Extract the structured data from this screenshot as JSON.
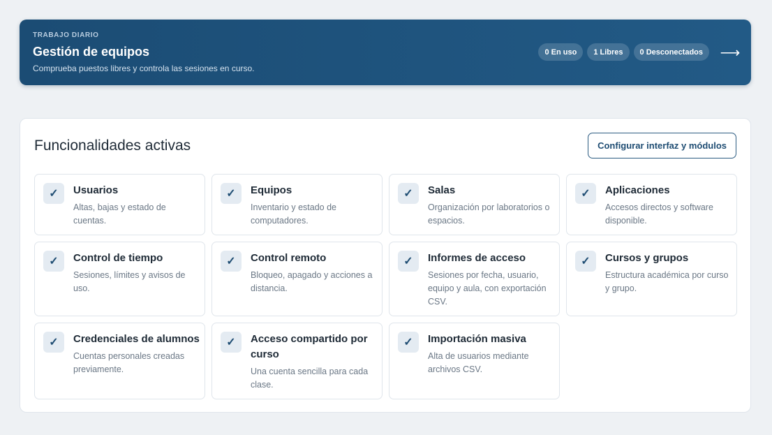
{
  "banner": {
    "eyebrow": "TRABAJO DIARIO",
    "title": "Gestión de equipos",
    "subtitle": "Comprueba puestos libres y controla las sesiones en curso.",
    "pills": [
      "0 En uso",
      "1 Libres",
      "0 Desconectados"
    ],
    "arrow": "⟶"
  },
  "panel": {
    "title": "Funcionalidades activas",
    "config_label": "Configurar interfaz y módulos"
  },
  "check_glyph": "✓",
  "cards": [
    {
      "title": "Usuarios",
      "desc": "Altas, bajas y estado de cuentas."
    },
    {
      "title": "Equipos",
      "desc": "Inventario y estado de computadores."
    },
    {
      "title": "Salas",
      "desc": "Organización por laboratorios o espacios."
    },
    {
      "title": "Aplicaciones",
      "desc": "Accesos directos y software disponible."
    },
    {
      "title": "Control de tiempo",
      "desc": "Sesiones, límites y avisos de uso."
    },
    {
      "title": "Control remoto",
      "desc": "Bloqueo, apagado y acciones a distancia."
    },
    {
      "title": "Informes de acceso",
      "desc": "Sesiones por fecha, usuario, equipo y aula, con exportación CSV."
    },
    {
      "title": "Cursos y grupos",
      "desc": "Estructura académica por curso y grupo."
    },
    {
      "title": "Credenciales de alumnos",
      "desc": "Cuentas personales creadas previamente."
    },
    {
      "title": "Acceso compartido por curso",
      "desc": "Una cuenta sencilla para cada clase."
    },
    {
      "title": "Importación masiva",
      "desc": "Alta de usuarios mediante archivos CSV."
    }
  ]
}
